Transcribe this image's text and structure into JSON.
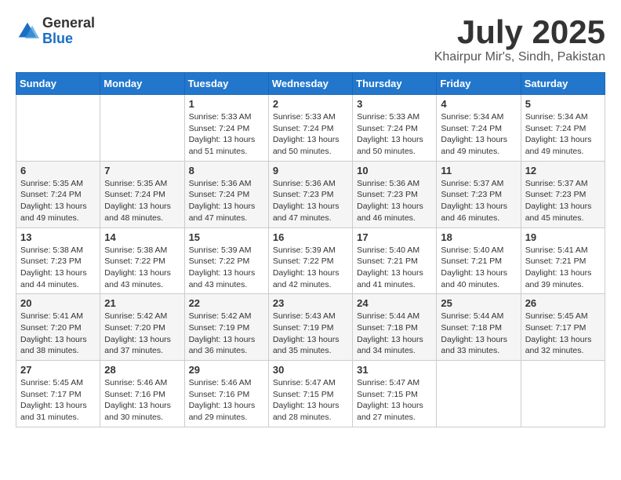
{
  "header": {
    "logo_general": "General",
    "logo_blue": "Blue",
    "month_title": "July 2025",
    "location": "Khairpur Mir's, Sindh, Pakistan"
  },
  "days_of_week": [
    "Sunday",
    "Monday",
    "Tuesday",
    "Wednesday",
    "Thursday",
    "Friday",
    "Saturday"
  ],
  "weeks": [
    [
      {
        "day": "",
        "info": ""
      },
      {
        "day": "",
        "info": ""
      },
      {
        "day": "1",
        "info": "Sunrise: 5:33 AM\nSunset: 7:24 PM\nDaylight: 13 hours and 51 minutes."
      },
      {
        "day": "2",
        "info": "Sunrise: 5:33 AM\nSunset: 7:24 PM\nDaylight: 13 hours and 50 minutes."
      },
      {
        "day": "3",
        "info": "Sunrise: 5:33 AM\nSunset: 7:24 PM\nDaylight: 13 hours and 50 minutes."
      },
      {
        "day": "4",
        "info": "Sunrise: 5:34 AM\nSunset: 7:24 PM\nDaylight: 13 hours and 49 minutes."
      },
      {
        "day": "5",
        "info": "Sunrise: 5:34 AM\nSunset: 7:24 PM\nDaylight: 13 hours and 49 minutes."
      }
    ],
    [
      {
        "day": "6",
        "info": "Sunrise: 5:35 AM\nSunset: 7:24 PM\nDaylight: 13 hours and 49 minutes."
      },
      {
        "day": "7",
        "info": "Sunrise: 5:35 AM\nSunset: 7:24 PM\nDaylight: 13 hours and 48 minutes."
      },
      {
        "day": "8",
        "info": "Sunrise: 5:36 AM\nSunset: 7:24 PM\nDaylight: 13 hours and 47 minutes."
      },
      {
        "day": "9",
        "info": "Sunrise: 5:36 AM\nSunset: 7:23 PM\nDaylight: 13 hours and 47 minutes."
      },
      {
        "day": "10",
        "info": "Sunrise: 5:36 AM\nSunset: 7:23 PM\nDaylight: 13 hours and 46 minutes."
      },
      {
        "day": "11",
        "info": "Sunrise: 5:37 AM\nSunset: 7:23 PM\nDaylight: 13 hours and 46 minutes."
      },
      {
        "day": "12",
        "info": "Sunrise: 5:37 AM\nSunset: 7:23 PM\nDaylight: 13 hours and 45 minutes."
      }
    ],
    [
      {
        "day": "13",
        "info": "Sunrise: 5:38 AM\nSunset: 7:23 PM\nDaylight: 13 hours and 44 minutes."
      },
      {
        "day": "14",
        "info": "Sunrise: 5:38 AM\nSunset: 7:22 PM\nDaylight: 13 hours and 43 minutes."
      },
      {
        "day": "15",
        "info": "Sunrise: 5:39 AM\nSunset: 7:22 PM\nDaylight: 13 hours and 43 minutes."
      },
      {
        "day": "16",
        "info": "Sunrise: 5:39 AM\nSunset: 7:22 PM\nDaylight: 13 hours and 42 minutes."
      },
      {
        "day": "17",
        "info": "Sunrise: 5:40 AM\nSunset: 7:21 PM\nDaylight: 13 hours and 41 minutes."
      },
      {
        "day": "18",
        "info": "Sunrise: 5:40 AM\nSunset: 7:21 PM\nDaylight: 13 hours and 40 minutes."
      },
      {
        "day": "19",
        "info": "Sunrise: 5:41 AM\nSunset: 7:21 PM\nDaylight: 13 hours and 39 minutes."
      }
    ],
    [
      {
        "day": "20",
        "info": "Sunrise: 5:41 AM\nSunset: 7:20 PM\nDaylight: 13 hours and 38 minutes."
      },
      {
        "day": "21",
        "info": "Sunrise: 5:42 AM\nSunset: 7:20 PM\nDaylight: 13 hours and 37 minutes."
      },
      {
        "day": "22",
        "info": "Sunrise: 5:42 AM\nSunset: 7:19 PM\nDaylight: 13 hours and 36 minutes."
      },
      {
        "day": "23",
        "info": "Sunrise: 5:43 AM\nSunset: 7:19 PM\nDaylight: 13 hours and 35 minutes."
      },
      {
        "day": "24",
        "info": "Sunrise: 5:44 AM\nSunset: 7:18 PM\nDaylight: 13 hours and 34 minutes."
      },
      {
        "day": "25",
        "info": "Sunrise: 5:44 AM\nSunset: 7:18 PM\nDaylight: 13 hours and 33 minutes."
      },
      {
        "day": "26",
        "info": "Sunrise: 5:45 AM\nSunset: 7:17 PM\nDaylight: 13 hours and 32 minutes."
      }
    ],
    [
      {
        "day": "27",
        "info": "Sunrise: 5:45 AM\nSunset: 7:17 PM\nDaylight: 13 hours and 31 minutes."
      },
      {
        "day": "28",
        "info": "Sunrise: 5:46 AM\nSunset: 7:16 PM\nDaylight: 13 hours and 30 minutes."
      },
      {
        "day": "29",
        "info": "Sunrise: 5:46 AM\nSunset: 7:16 PM\nDaylight: 13 hours and 29 minutes."
      },
      {
        "day": "30",
        "info": "Sunrise: 5:47 AM\nSunset: 7:15 PM\nDaylight: 13 hours and 28 minutes."
      },
      {
        "day": "31",
        "info": "Sunrise: 5:47 AM\nSunset: 7:15 PM\nDaylight: 13 hours and 27 minutes."
      },
      {
        "day": "",
        "info": ""
      },
      {
        "day": "",
        "info": ""
      }
    ]
  ]
}
